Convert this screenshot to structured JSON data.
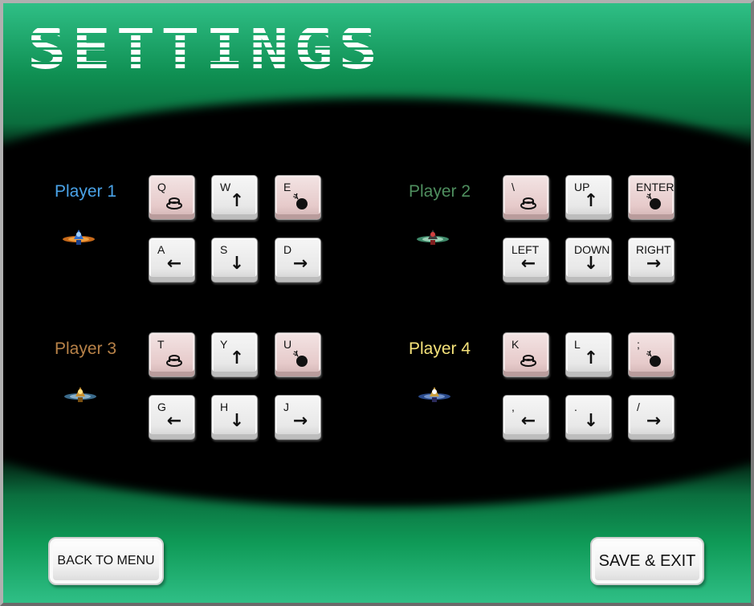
{
  "title": "SETTINGS",
  "colors": {
    "player1": "#4aa3e8",
    "player2": "#4f8f5f",
    "player3": "#b88248",
    "player4": "#f5e27a",
    "accent_green": "#1fa36a"
  },
  "players": [
    {
      "label": "Player 1",
      "keys": {
        "fire": "Q",
        "up": "W",
        "bomb": "E",
        "left": "A",
        "down": "S",
        "right": "D"
      }
    },
    {
      "label": "Player 2",
      "keys": {
        "fire": "\\",
        "up": "UP",
        "bomb": "ENTER",
        "left": "LEFT",
        "down": "DOWN",
        "right": "RIGHT"
      }
    },
    {
      "label": "Player 3",
      "keys": {
        "fire": "T",
        "up": "Y",
        "bomb": "U",
        "left": "G",
        "down": "H",
        "right": "J"
      }
    },
    {
      "label": "Player 4",
      "keys": {
        "fire": "K",
        "up": "L",
        "bomb": ";",
        "left": ",",
        "down": ".",
        "right": "/"
      }
    }
  ],
  "icons": {
    "fire": "fire-button-icon",
    "bomb": "bomb-icon",
    "up": "arrow-up-icon",
    "down": "arrow-down-icon",
    "left": "arrow-left-icon",
    "right": "arrow-right-icon"
  },
  "buttons": {
    "back": "BACK TO MENU",
    "save": "SAVE & EXIT"
  }
}
